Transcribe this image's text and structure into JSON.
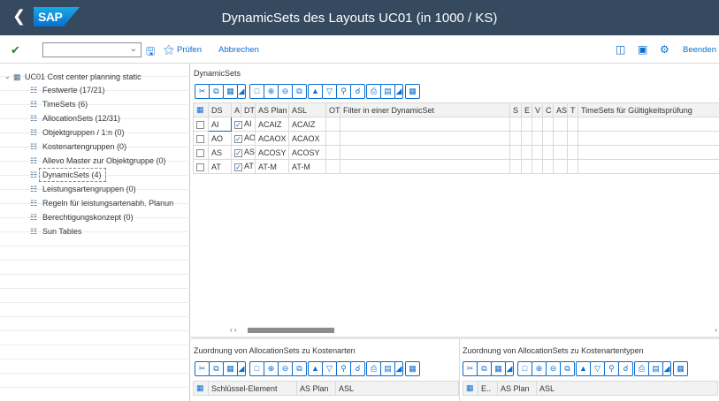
{
  "header": {
    "title": "DynamicSets des Layouts UC01 (in 1000 / KS)",
    "logo": "SAP"
  },
  "toolbar": {
    "pruefen": "Prüfen",
    "abbrechen": "Abbrechen",
    "beenden": "Beenden"
  },
  "tree": {
    "root": "UC01 Cost center planning static",
    "items": [
      "Festwerte (17/21)",
      "TimeSets (6)",
      "AllocationSets (12/31)",
      "Objektgruppen / 1:n (0)",
      "Kostenartengruppen (0)",
      "Allevo Master zur Objektgruppe (0)",
      "DynamicSets (4)",
      "Leistungsartengruppen (0)",
      "Regeln für leistungsartenabh. Planun",
      "Berechtigungskonzept (0)",
      "Sun Tables"
    ]
  },
  "dynamicsets": {
    "title": "DynamicSets",
    "columns": [
      "DS",
      "A",
      "DT",
      "AS Plan",
      "ASL",
      "OT",
      "Filter in einer DynamicSet",
      "S",
      "E",
      "V",
      "C",
      "AS",
      "T",
      "TimeSets für Gültigkeitsprüfung"
    ],
    "rows": [
      {
        "ds": "AI",
        "dt": "AI",
        "asplan": "ACAIZ",
        "asl": "ACAIZ"
      },
      {
        "ds": "AO",
        "dt": "AO",
        "asplan": "ACAOX",
        "asl": "ACAOX"
      },
      {
        "ds": "AS",
        "dt": "AS",
        "asplan": "ACOSY",
        "asl": "ACOSY"
      },
      {
        "ds": "AT",
        "dt": "AT",
        "asplan": "AT-M",
        "asl": "AT-M"
      }
    ]
  },
  "bottom_left": {
    "title": "Zuordnung von AllocationSets zu Kostenarten",
    "columns": [
      "Schlüssel-Element",
      "AS Plan",
      "ASL"
    ]
  },
  "bottom_right": {
    "title": "Zuordnung von AllocationSets zu Kostenartentypen",
    "columns": [
      "E..",
      "AS Plan",
      "ASL"
    ]
  }
}
